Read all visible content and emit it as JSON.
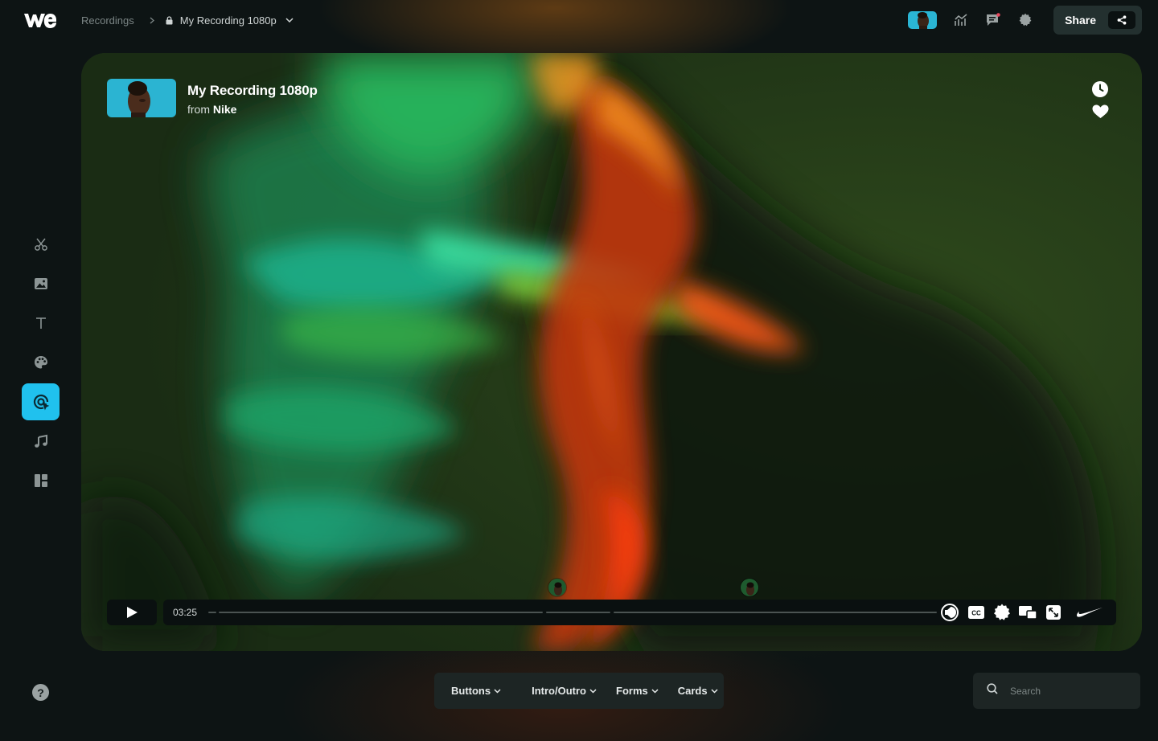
{
  "app": {
    "logo_text": "we"
  },
  "breadcrumb": {
    "root": "Recordings",
    "current": "My Recording 1080p"
  },
  "header": {
    "share_label": "Share",
    "icons": [
      "analytics-icon",
      "comment-icon",
      "settings-icon",
      "share-icon"
    ]
  },
  "sidebar": {
    "items": [
      {
        "icon": "scissors-icon",
        "active": false
      },
      {
        "icon": "image-icon",
        "active": false
      },
      {
        "icon": "text-icon",
        "active": false
      },
      {
        "icon": "palette-icon",
        "active": false
      },
      {
        "icon": "at-sign-cursor-icon",
        "active": true
      },
      {
        "icon": "music-icon",
        "active": false
      },
      {
        "icon": "layout-icon",
        "active": false
      }
    ],
    "help_label": "?"
  },
  "video": {
    "title": "My Recording 1080p",
    "from_prefix": "from",
    "from_name": "Nike",
    "current_time": "03:25",
    "progress": 0.0,
    "controls": [
      "volume-icon",
      "closed-captions-icon",
      "settings-gear-icon",
      "picture-in-picture-icon",
      "fullscreen-icon",
      "nike-logo-icon"
    ],
    "cc_label": "CC"
  },
  "bottom_menu": {
    "items": [
      {
        "label": "Buttons"
      },
      {
        "label": "Intro/Outro"
      },
      {
        "label": "Forms"
      },
      {
        "label": "Cards"
      }
    ]
  },
  "search": {
    "placeholder": "Search"
  },
  "colors": {
    "accent": "#20c1ee",
    "background": "#0d1414",
    "panel": "#1d2524"
  }
}
